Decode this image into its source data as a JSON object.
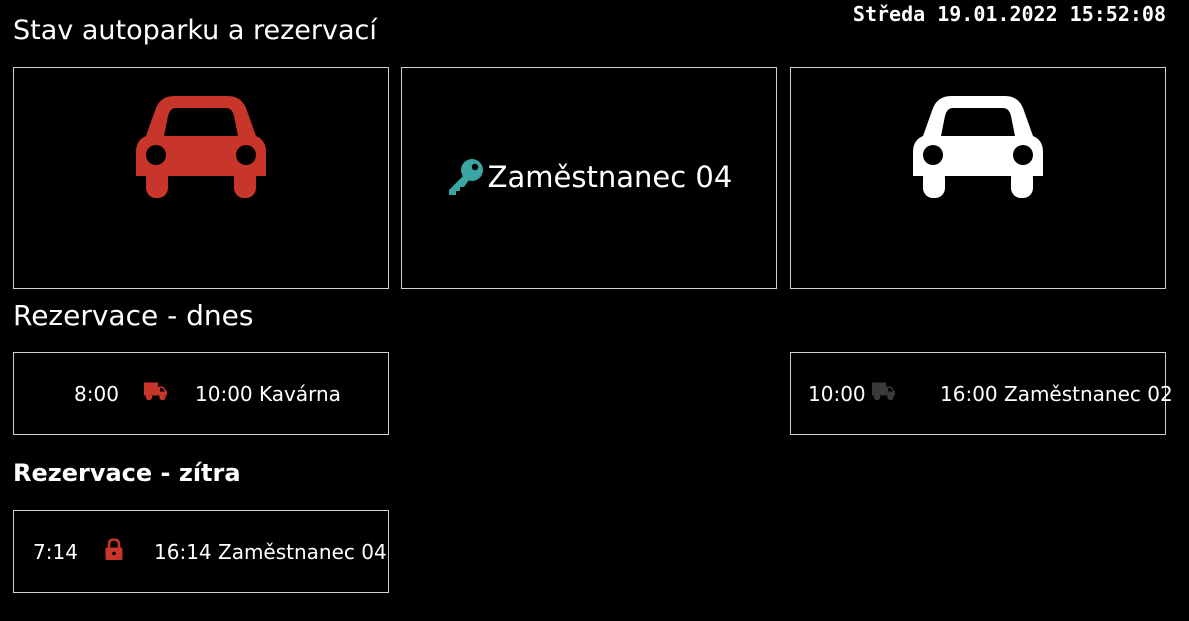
{
  "header": {
    "title": "Stav autoparku a rezervací",
    "datetime": "Středa 19.01.2022 15:52:08"
  },
  "colors": {
    "red": "#c8352a",
    "teal": "#3aa5a4",
    "white": "#ffffff",
    "grey": "#3a3a3a"
  },
  "cars": [
    {
      "icon": "car-icon",
      "state": "red"
    },
    {
      "icon": "key-icon",
      "label": "Zaměstnanec 04"
    },
    {
      "icon": "car-icon",
      "state": "white"
    }
  ],
  "reservations_today": {
    "title": "Rezervace - dnes",
    "items": [
      {
        "from": "8:00",
        "icon": "truck-icon",
        "to_label": "10:00 Kavárna"
      },
      {
        "from": "10:00",
        "icon": "truck-icon",
        "to_label": "16:00 Zaměstnanec 02"
      }
    ]
  },
  "reservations_tomorrow": {
    "title": "Rezervace - zítra",
    "items": [
      {
        "from": "7:14",
        "icon": "lock-icon",
        "to_label": "16:14 Zaměstnanec 04"
      }
    ]
  }
}
